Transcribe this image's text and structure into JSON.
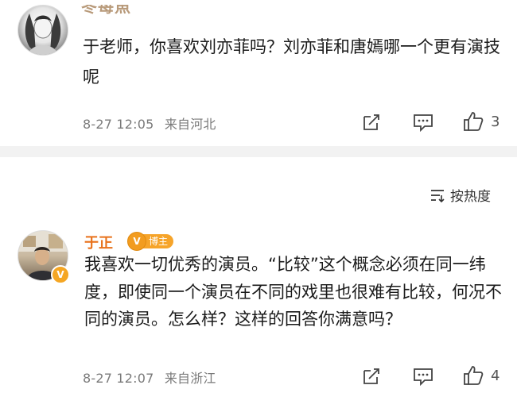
{
  "comment1": {
    "username_partial": "冬每魚",
    "text": "于老师，你喜欢刘亦菲吗？刘亦菲和唐嫣哪一个更有演技呢",
    "time": "8-27 12:05",
    "location": "来自河北",
    "like_count": "3",
    "icons": [
      "share-icon",
      "comment-icon",
      "like-icon"
    ]
  },
  "sort": {
    "label": "按热度",
    "icon": "sort-icon"
  },
  "comment2": {
    "username": "于正",
    "badge_label": "博主",
    "verified_icon": "verified-v-icon",
    "text": "我喜欢一切优秀的演员。“比较”这个概念必须在同一纬度，即使同一个演员在不同的戏里也很难有比较，何况不同的演员。怎么样？这样的回答你满意吗？",
    "time": "8-27 12:07",
    "location": "来自浙江",
    "like_count": "4",
    "icons": [
      "share-icon",
      "comment-icon",
      "like-icon"
    ]
  },
  "colors": {
    "username_accent": "#e8711a",
    "badge": "#f6a42a",
    "meta_text": "#7a7a7a",
    "separator": "#f2f2f2"
  }
}
